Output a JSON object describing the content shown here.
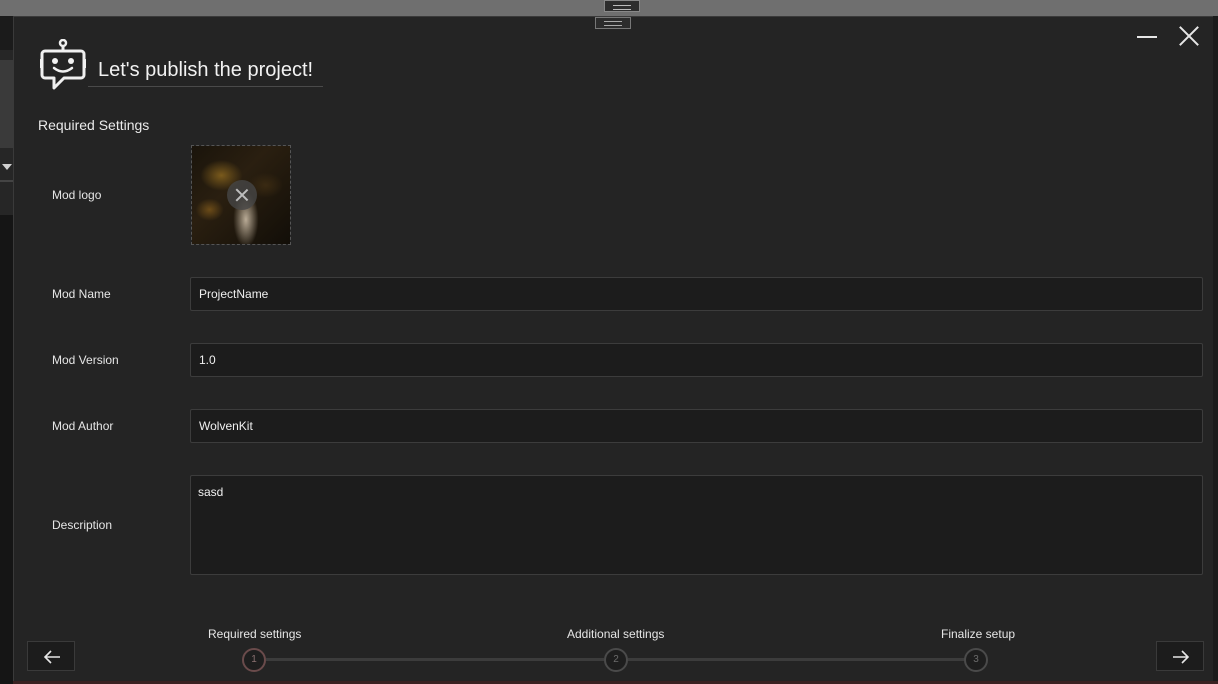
{
  "dialog": {
    "title": "Let's publish the project!",
    "section_title": "Required Settings"
  },
  "fields": {
    "logo_label": "Mod logo",
    "name_label": "Mod Name",
    "name_value": "ProjectName",
    "version_label": "Mod Version",
    "version_value": "1.0",
    "author_label": "Mod Author",
    "author_value": "WolvenKit",
    "description_label": "Description",
    "description_value": "sasd"
  },
  "steps": [
    {
      "label": "Required settings",
      "number": "1",
      "active": true
    },
    {
      "label": "Additional settings",
      "number": "2",
      "active": false
    },
    {
      "label": "Finalize setup",
      "number": "3",
      "active": false
    }
  ],
  "icons": {
    "logo": "robot-chat-icon",
    "back": "arrow-left-icon",
    "next": "arrow-right-icon",
    "minimize": "minimize-icon",
    "close": "close-icon",
    "remove_logo": "close-icon"
  },
  "colors": {
    "dialog_bg": "#242424",
    "field_bg": "#1c1c1c",
    "active_step": "#6a4b4b"
  }
}
